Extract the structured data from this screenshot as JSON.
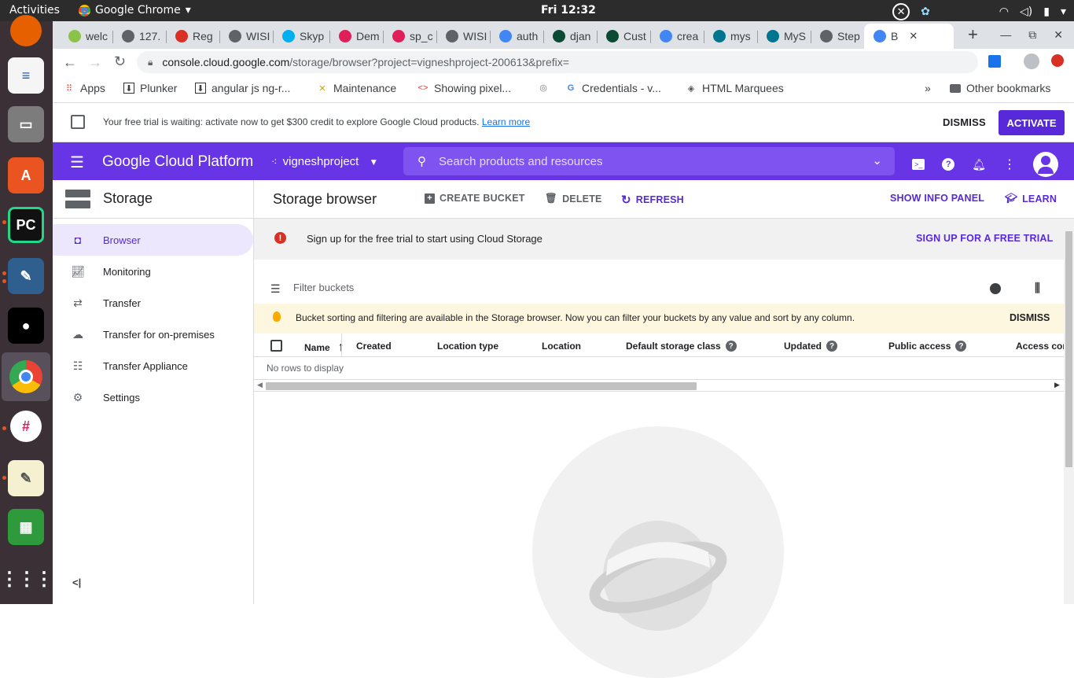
{
  "system": {
    "activities": "Activities",
    "app_name": "Google Chrome",
    "clock": "Fri 12:32"
  },
  "browser": {
    "tabs": [
      {
        "label": "welc",
        "color": "#8bc34a"
      },
      {
        "label": "127.",
        "color": "#5f6368"
      },
      {
        "label": "Reg",
        "color": "#d93025"
      },
      {
        "label": "WISI",
        "color": "#5f6368"
      },
      {
        "label": "Skyp",
        "color": "#00aff0"
      },
      {
        "label": "Dem",
        "color": "#e01e5a"
      },
      {
        "label": "sp_c",
        "color": "#e01e5a"
      },
      {
        "label": "WISI",
        "color": "#5f6368"
      },
      {
        "label": "auth",
        "color": "#4285f4"
      },
      {
        "label": "djan",
        "color": "#0c4b33"
      },
      {
        "label": "Cust",
        "color": "#0c4b33"
      },
      {
        "label": "crea",
        "color": "#4285f4"
      },
      {
        "label": "mys",
        "color": "#00758f"
      },
      {
        "label": "MyS",
        "color": "#00758f"
      },
      {
        "label": "Step",
        "color": "#5f6368"
      },
      {
        "label": "B",
        "color": "#4285f4"
      }
    ],
    "url_host": "console.cloud.google.com",
    "url_path": "/storage/browser?project=vigneshproject-200613&prefix=",
    "bookmarks": [
      "Apps",
      "Plunker",
      "angular js ng-r...",
      "Maintenance",
      "Showing pixel...",
      "Credentials - v...",
      "HTML Marquees"
    ],
    "bookmarks_more": "»",
    "other_bookmarks": "Other bookmarks"
  },
  "trial_banner": {
    "message": "Your free trial is waiting: activate now to get $300 credit to explore Google Cloud products.",
    "link": "Learn more",
    "dismiss": "DISMISS",
    "activate": "ACTIVATE"
  },
  "gcp": {
    "title": "Google Cloud Platform",
    "project": "vigneshproject",
    "search_placeholder": "Search products and resources",
    "accent": "#6734e6"
  },
  "sidebar": {
    "title": "Storage",
    "items": [
      {
        "label": "Browser",
        "icon": "bucket-icon",
        "selected": true
      },
      {
        "label": "Monitoring",
        "icon": "monitoring-icon"
      },
      {
        "label": "Transfer",
        "icon": "transfer-icon"
      },
      {
        "label": "Transfer for on-premises",
        "icon": "cloud-upload-icon"
      },
      {
        "label": "Transfer Appliance",
        "icon": "appliance-icon"
      },
      {
        "label": "Settings",
        "icon": "gear-icon"
      }
    ],
    "collapse": "<|"
  },
  "main": {
    "title": "Storage browser",
    "toolbar": {
      "create": "CREATE BUCKET",
      "delete": "DELETE",
      "refresh": "REFRESH",
      "info_panel": "SHOW INFO PANEL",
      "learn": "LEARN"
    },
    "alert": {
      "message": "Sign up for the free trial to start using Cloud Storage",
      "action": "SIGN UP FOR A FREE TRIAL"
    },
    "filter_placeholder": "Filter buckets",
    "tip": {
      "message": "Bucket sorting and filtering are available in the Storage browser. Now you can filter your buckets by any value and sort by any column.",
      "dismiss": "DISMISS"
    },
    "columns": [
      "Name",
      "Created",
      "Location type",
      "Location",
      "Default storage class",
      "Updated",
      "Public access",
      "Access cor"
    ],
    "empty": "No rows to display"
  }
}
